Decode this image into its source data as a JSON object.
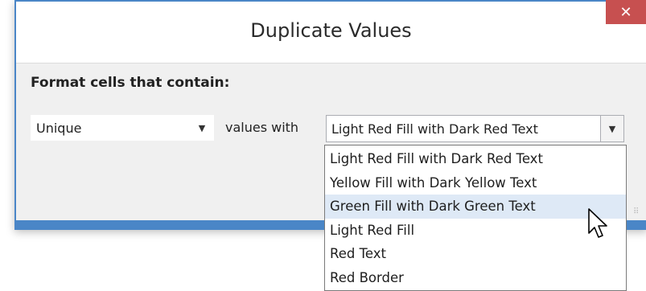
{
  "dialog": {
    "title": "Duplicate Values",
    "close_icon": "close-icon",
    "prompt": "Format cells that contain:",
    "type_combo": {
      "selected": "Unique"
    },
    "values_with_label": "values with",
    "format_combo": {
      "selected": "Light Red Fill with Dark Red Text"
    }
  },
  "dropdown": {
    "items": [
      {
        "label": "Light Red Fill with Dark Red Text"
      },
      {
        "label": "Yellow Fill with Dark Yellow Text"
      },
      {
        "label": "Green Fill with Dark Green Text"
      },
      {
        "label": "Light Red Fill"
      },
      {
        "label": "Red Text"
      },
      {
        "label": "Red Border"
      }
    ],
    "hovered_index": 2
  },
  "colors": {
    "window_border": "#4a86c7",
    "close_button": "#c75050",
    "hover_highlight": "#dee9f6"
  }
}
